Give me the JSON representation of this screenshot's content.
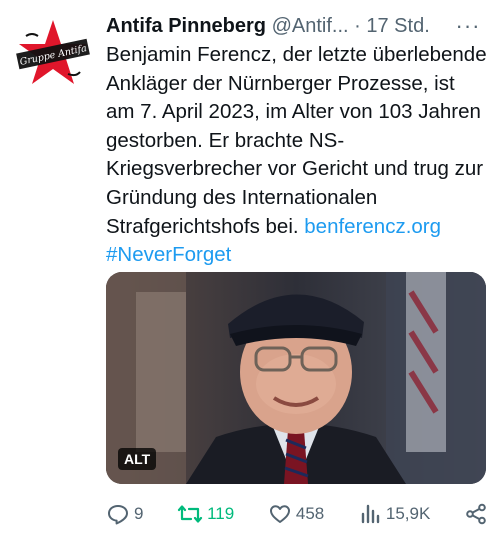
{
  "author": {
    "name": "Antifa Pinneberg",
    "handle": "@Antif...",
    "separator": "·",
    "time": "17 Std.",
    "more_label": "···",
    "avatar_text": "Gruppe Antifa"
  },
  "tweet": {
    "text": "Benjamin Ferencz, der letzte überlebende Ankläger der Nürnberger Prozesse, ist am 7. April 2023, im Alter von 103 Jahren gestorben. Er brachte NS-Kriegsverbrecher vor Gericht und trug zur Gründung des Internationalen Strafgerichtshofs bei. ",
    "link": "benferencz.org",
    "hashtag": "#NeverForget"
  },
  "media": {
    "alt_badge": "ALT"
  },
  "actions": {
    "replies": "9",
    "retweets": "119",
    "likes": "458",
    "views": "15,9K"
  },
  "colors": {
    "text": "#0f1419",
    "secondary": "#536471",
    "link": "#1d9bf0",
    "retweet_active": "#00ba7c",
    "avatar_star": "#e0162b"
  }
}
